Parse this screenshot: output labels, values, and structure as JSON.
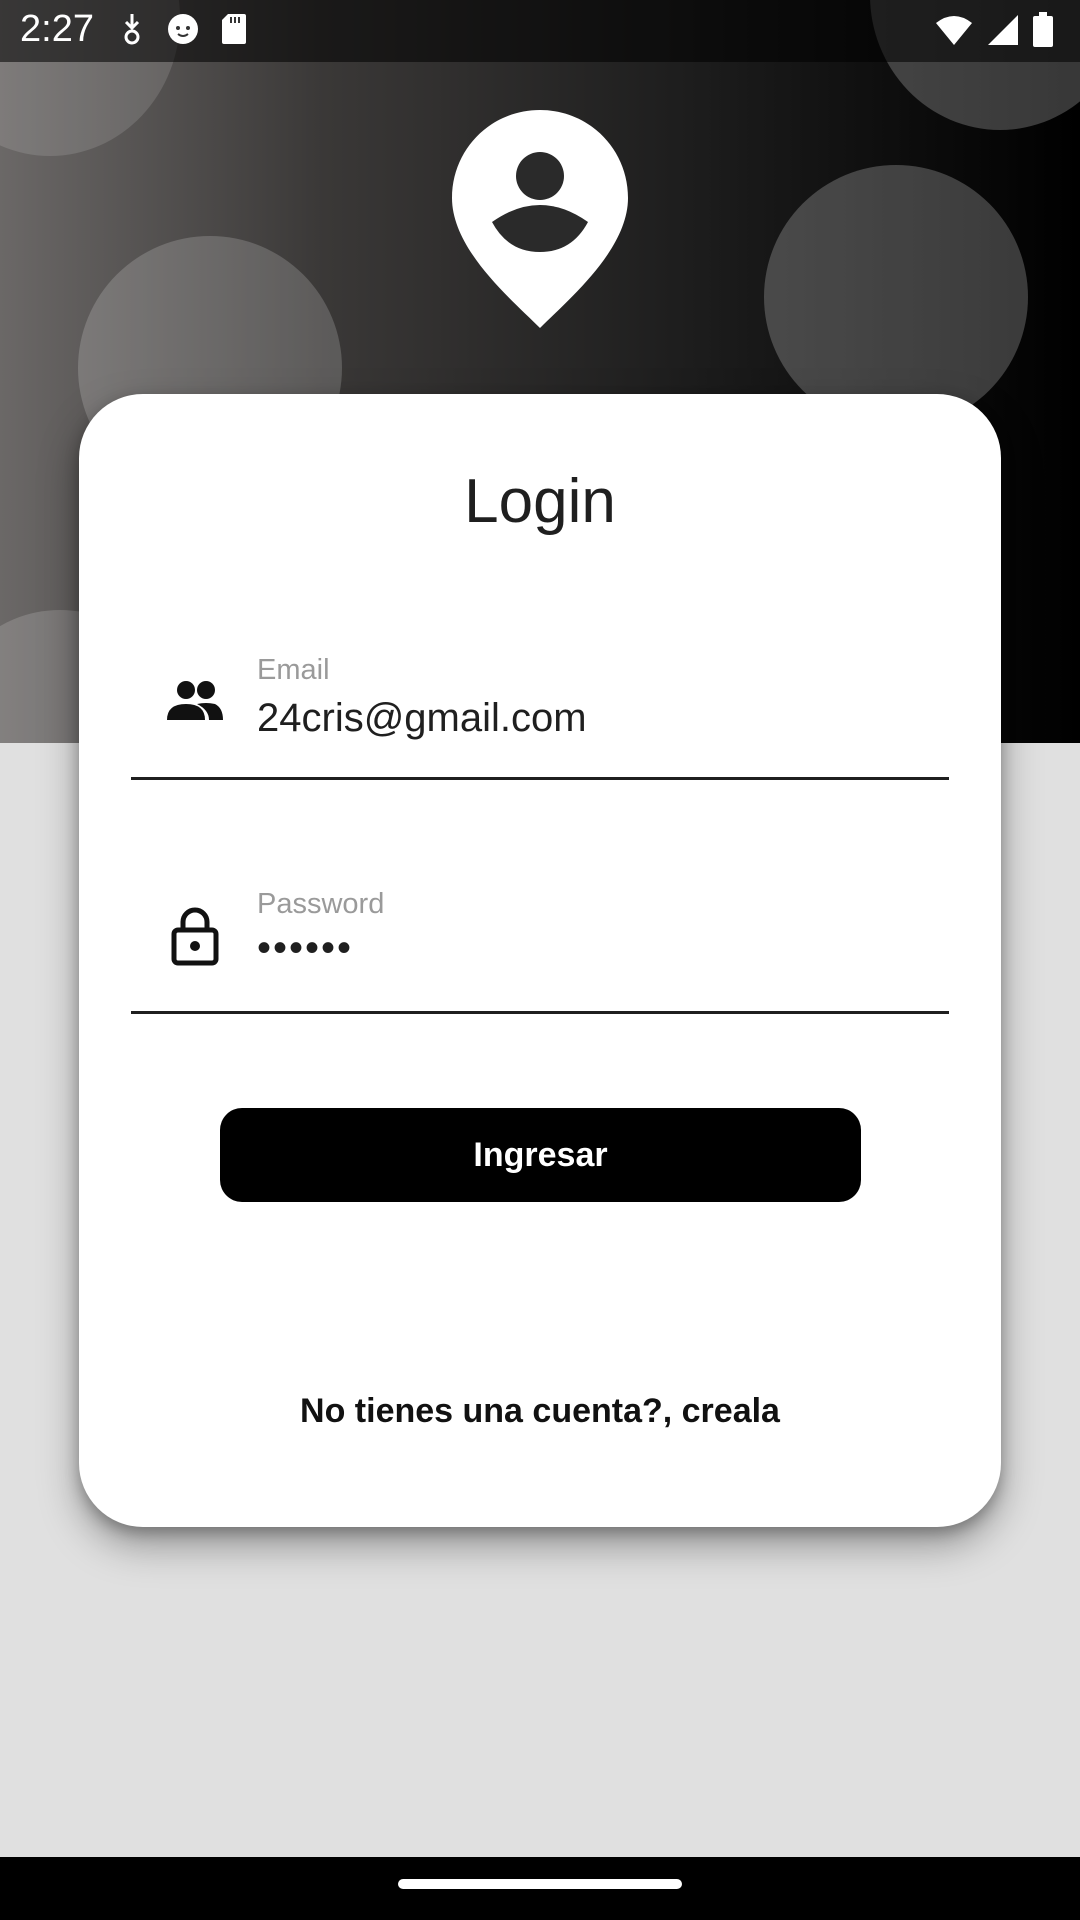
{
  "status_bar": {
    "time": "2:27",
    "icons": [
      "download-icon",
      "cat-face-icon",
      "sd-card-icon",
      "wifi-icon",
      "signal-icon",
      "battery-icon"
    ]
  },
  "logo": {
    "icon": "person-pin-icon"
  },
  "login": {
    "title": "Login",
    "email": {
      "label": "Email",
      "value": "24cris@gmail.com",
      "icon": "people-icon"
    },
    "password": {
      "label": "Password",
      "value": "••••••",
      "icon": "lock-icon"
    },
    "submit_label": "Ingresar",
    "register_link": "No tienes una cuenta?, creala"
  },
  "colors": {
    "accent": "#000000",
    "card": "#ffffff",
    "page_background": "#e0e0e0"
  }
}
